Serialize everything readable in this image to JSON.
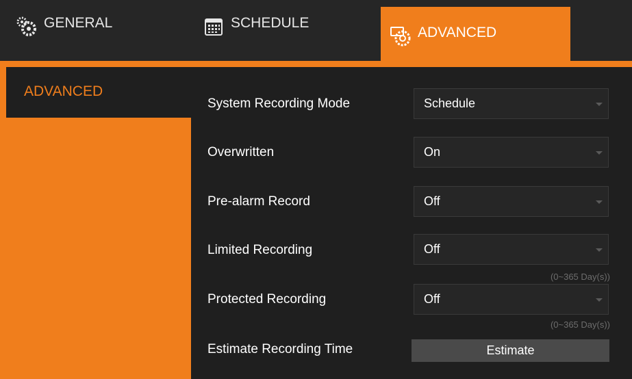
{
  "tabs": {
    "general": {
      "label": "GENERAL",
      "icon": "gears-icon"
    },
    "schedule": {
      "label": "SCHEDULE",
      "icon": "calendar-icon"
    },
    "advanced": {
      "label": "ADVANCED",
      "icon": "advanced-camera-gear-icon"
    }
  },
  "sidebar": {
    "items": [
      {
        "label": "ADVANCED"
      }
    ]
  },
  "form": {
    "rows": [
      {
        "label": "System Recording Mode",
        "value": "Schedule"
      },
      {
        "label": "Overwritten",
        "value": "On"
      },
      {
        "label": "Pre-alarm Record",
        "value": "Off"
      },
      {
        "label": "Limited Recording",
        "value": "Off",
        "hint": "(0~365 Day(s))"
      },
      {
        "label": "Protected Recording",
        "value": "Off",
        "hint": "(0~365 Day(s))"
      }
    ],
    "estimate": {
      "label": "Estimate Recording Time",
      "button": "Estimate"
    }
  },
  "colors": {
    "accent": "#f07e1c",
    "background": "#1f1f1f"
  }
}
